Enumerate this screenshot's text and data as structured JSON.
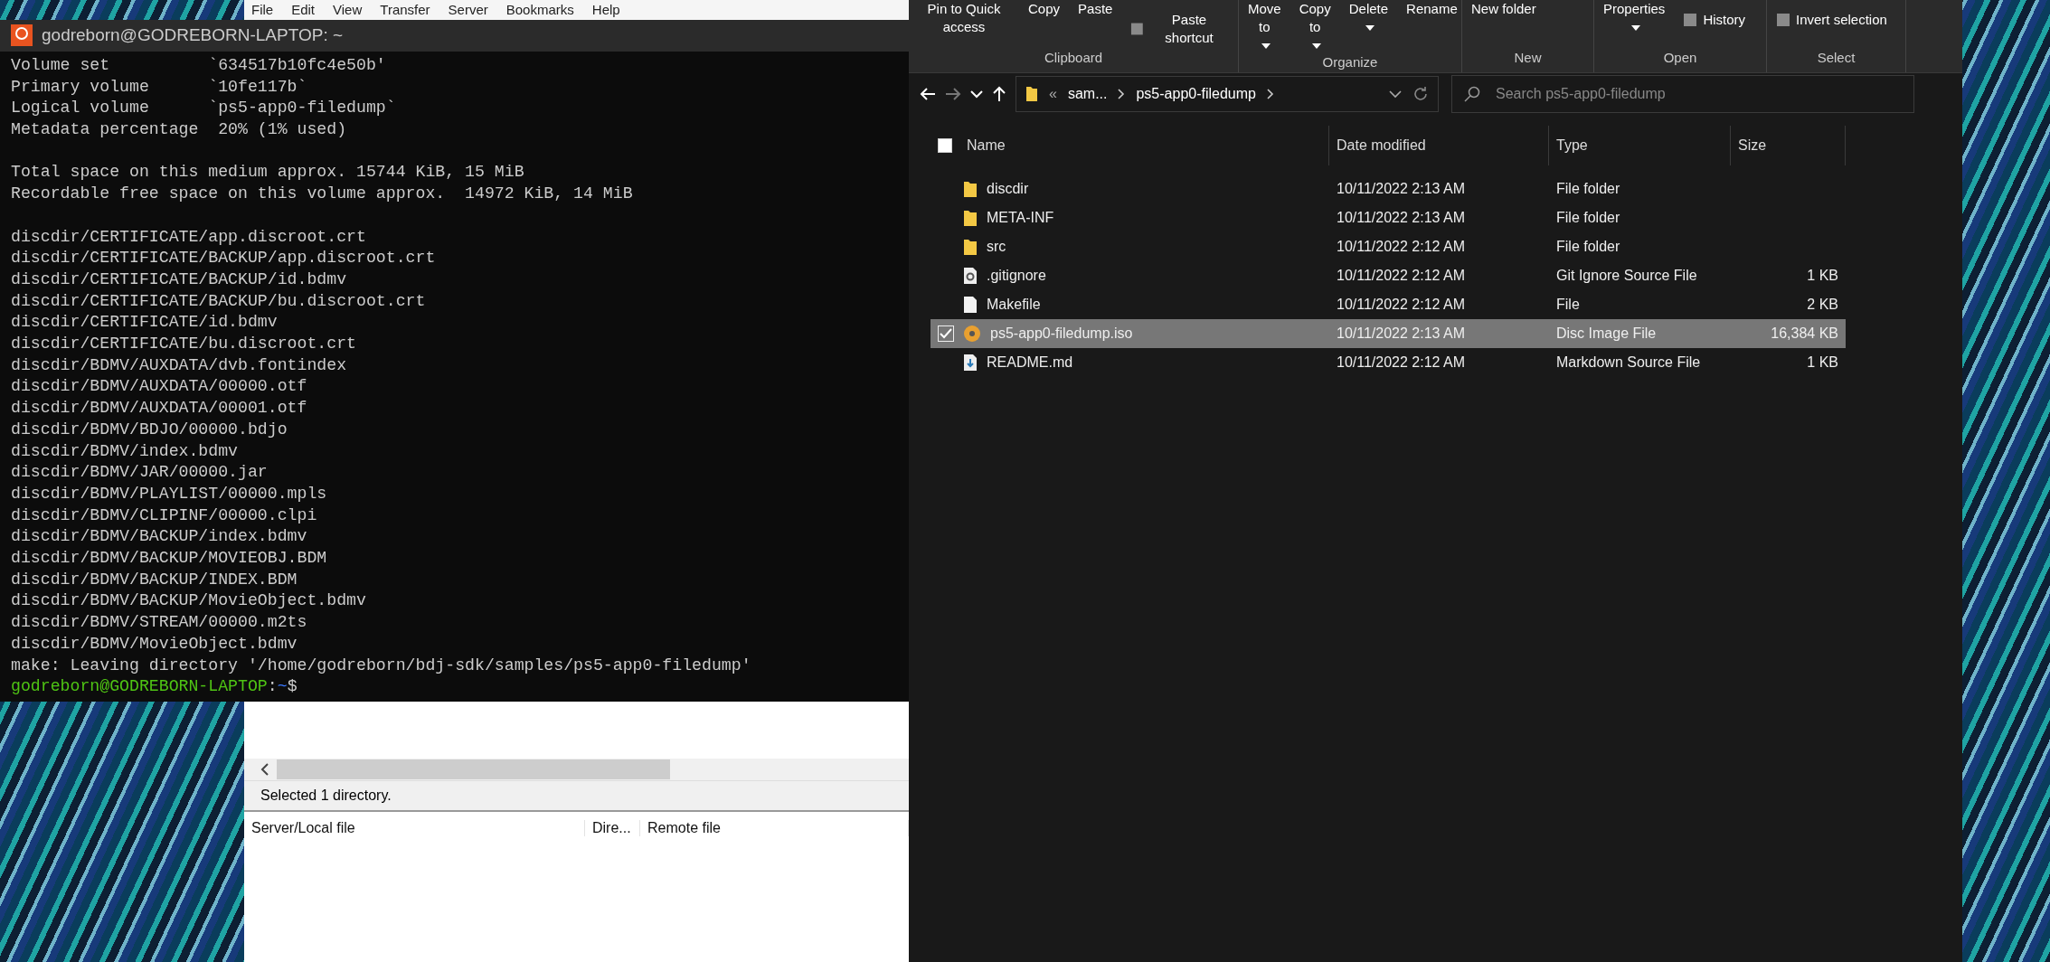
{
  "filezilla": {
    "menu": [
      "File",
      "Edit",
      "View",
      "Transfer",
      "Server",
      "Bookmarks",
      "Help"
    ],
    "status_text": "Selected 1 directory.",
    "queue_columns": [
      "Server/Local file",
      "Dire...",
      "Remote file"
    ]
  },
  "terminal": {
    "title": "godreborn@GODREBORN-LAPTOP: ~",
    "blocks": [
      [
        "Volume set          `634517b10fc4e50b'",
        "Primary volume      `10fe117b`",
        "Logical volume      `ps5-app0-filedump`",
        "Metadata percentage  20% (1% used)"
      ],
      [
        "Total space on this medium approx. 15744 KiB, 15 MiB",
        "Recordable free space on this volume approx.  14972 KiB, 14 MiB"
      ],
      [
        "discdir/CERTIFICATE/app.discroot.crt",
        "discdir/CERTIFICATE/BACKUP/app.discroot.crt",
        "discdir/CERTIFICATE/BACKUP/id.bdmv",
        "discdir/CERTIFICATE/BACKUP/bu.discroot.crt",
        "discdir/CERTIFICATE/id.bdmv",
        "discdir/CERTIFICATE/bu.discroot.crt",
        "discdir/BDMV/AUXDATA/dvb.fontindex",
        "discdir/BDMV/AUXDATA/00000.otf",
        "discdir/BDMV/AUXDATA/00001.otf",
        "discdir/BDMV/BDJO/00000.bdjo",
        "discdir/BDMV/index.bdmv",
        "discdir/BDMV/JAR/00000.jar",
        "discdir/BDMV/PLAYLIST/00000.mpls",
        "discdir/BDMV/CLIPINF/00000.clpi",
        "discdir/BDMV/BACKUP/index.bdmv",
        "discdir/BDMV/BACKUP/MOVIEOBJ.BDM",
        "discdir/BDMV/BACKUP/INDEX.BDM",
        "discdir/BDMV/BACKUP/MovieObject.bdmv",
        "discdir/BDMV/STREAM/00000.m2ts",
        "discdir/BDMV/MovieObject.bdmv",
        "make: Leaving directory '/home/godreborn/bdj-sdk/samples/ps5-app0-filedump'"
      ]
    ],
    "prompt": {
      "user_host": "godreborn@GODREBORN-LAPTOP",
      "separator": ":",
      "path": "~",
      "symbol": "$"
    }
  },
  "explorer": {
    "ribbon_groups": [
      {
        "label": "Clipboard",
        "buttons": [
          {
            "label": "Pin to Quick access",
            "kind": "large",
            "dropdown": false
          },
          {
            "label": "Copy",
            "kind": "large",
            "dropdown": false
          },
          {
            "label": "Paste",
            "kind": "large",
            "dropdown": false
          },
          {
            "label": "Paste shortcut",
            "kind": "small",
            "dropdown": false
          }
        ]
      },
      {
        "label": "Organize",
        "buttons": [
          {
            "label": "Move to",
            "kind": "large",
            "dropdown": true
          },
          {
            "label": "Copy to",
            "kind": "large",
            "dropdown": true
          },
          {
            "label": "Delete",
            "kind": "large",
            "dropdown": true
          },
          {
            "label": "Rename",
            "kind": "large",
            "dropdown": false
          }
        ]
      },
      {
        "label": "New",
        "buttons": [
          {
            "label": "New folder",
            "kind": "large",
            "dropdown": false
          }
        ]
      },
      {
        "label": "Open",
        "buttons": [
          {
            "label": "Properties",
            "kind": "large",
            "dropdown": true
          },
          {
            "label": "History",
            "kind": "small",
            "dropdown": false
          }
        ]
      },
      {
        "label": "Select",
        "buttons": [
          {
            "label": "Invert selection",
            "kind": "small",
            "dropdown": false
          }
        ]
      }
    ],
    "address": {
      "overflow": "«",
      "crumbs": [
        "sam...",
        "ps5-app0-filedump"
      ]
    },
    "search": {
      "placeholder": "Search ps5-app0-filedump"
    },
    "select_all": {
      "checked": false
    },
    "columns": [
      "Name",
      "Date modified",
      "Type",
      "Size"
    ],
    "rows": [
      {
        "name": "discdir",
        "date": "10/11/2022 2:13 AM",
        "type": "File folder",
        "kind": "folder",
        "selected": false
      },
      {
        "name": "META-INF",
        "date": "10/11/2022 2:13 AM",
        "type": "File folder",
        "kind": "folder",
        "selected": false
      },
      {
        "name": "src",
        "date": "10/11/2022 2:12 AM",
        "type": "File folder",
        "kind": "folder",
        "selected": false
      },
      {
        "name": ".gitignore",
        "date": "10/11/2022 2:12 AM",
        "type": "Git Ignore Source File",
        "size": "1 KB",
        "kind": "settings",
        "selected": false
      },
      {
        "name": "Makefile",
        "date": "10/11/2022 2:12 AM",
        "type": "File",
        "size": "2 KB",
        "kind": "file",
        "selected": false
      },
      {
        "name": "ps5-app0-filedump.iso",
        "date": "10/11/2022 2:13 AM",
        "type": "Disc Image File",
        "size": "16,384 KB",
        "kind": "disc",
        "selected": true
      },
      {
        "name": "README.md",
        "date": "10/11/2022 2:12 AM",
        "type": "Markdown Source File",
        "size": "1 KB",
        "kind": "markdown",
        "selected": false
      }
    ]
  }
}
